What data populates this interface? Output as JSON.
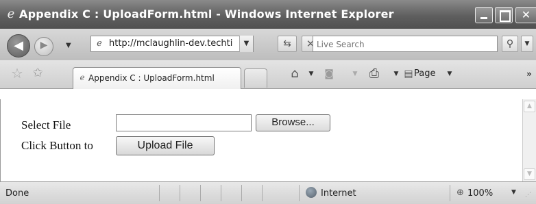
{
  "window": {
    "title": "Appendix C : UploadForm.html - Windows Internet Explorer"
  },
  "toolbar": {
    "address": "http://mclaughlin-dev.techti",
    "search_placeholder": "Live Search"
  },
  "tabs": {
    "active_label": "Appendix C : UploadForm.html",
    "page_menu_label": "Page"
  },
  "content": {
    "select_file_label": "Select File",
    "browse_label": "Browse...",
    "click_button_label": "Click Button to",
    "upload_label": "Upload File",
    "file_value": ""
  },
  "status": {
    "text": "Done",
    "zone": "Internet",
    "zoom": "100%"
  },
  "icons": {
    "back": "back-arrow-icon",
    "forward": "forward-arrow-icon",
    "home": "home-icon",
    "print": "printer-icon",
    "feeds": "feeds-icon",
    "favorites": "favorites-star-icon",
    "globe": "internet-globe-icon"
  }
}
